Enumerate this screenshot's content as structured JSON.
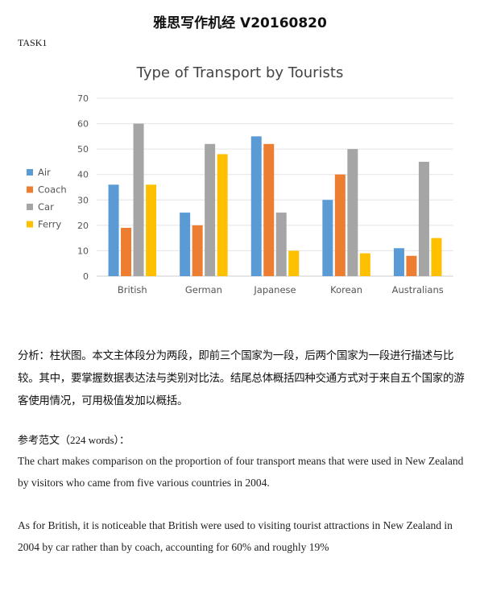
{
  "document": {
    "title": "雅思写作机经  V20160820",
    "task_label": "TASK1",
    "analysis": "分析：柱状图。本文主体段分为两段，即前三个国家为一段，后两个国家为一段进行描述与比较。其中，要掌握数据表达法与类别对比法。结尾总体概括四种交通方式对于来自五个国家的游客使用情况，可用极值发加以概括。",
    "reference_label": "参考范文（",
    "reference_words": "224 words",
    "reference_end": "）：",
    "paragraph1": "The chart makes comparison on the proportion of four transport means that were used in New Zealand by visitors who came from five various countries in 2004.",
    "paragraph2": "As for British, it is noticeable that British were used to visiting tourist attractions in New Zealand in 2004 by car rather than by coach, accounting for 60% and roughly 19%"
  },
  "chart_data": {
    "type": "bar",
    "title": "Type of Transport by Tourists",
    "categories": [
      "British",
      "German",
      "Japanese",
      "Korean",
      "Australians"
    ],
    "series": [
      {
        "name": "Air",
        "color": "#5B9BD5",
        "values": [
          36,
          25,
          55,
          30,
          11
        ]
      },
      {
        "name": "Coach",
        "color": "#ED7D31",
        "values": [
          19,
          20,
          52,
          40,
          8
        ]
      },
      {
        "name": "Car",
        "color": "#A5A5A5",
        "values": [
          60,
          52,
          25,
          50,
          45
        ]
      },
      {
        "name": "Ferry",
        "color": "#FFC000",
        "values": [
          36,
          48,
          10,
          9,
          15
        ]
      }
    ],
    "ylim": [
      0,
      70
    ],
    "yticks": [
      0,
      10,
      20,
      30,
      40,
      50,
      60,
      70
    ],
    "grid": true,
    "legend": "left",
    "xlabel": "",
    "ylabel": ""
  }
}
